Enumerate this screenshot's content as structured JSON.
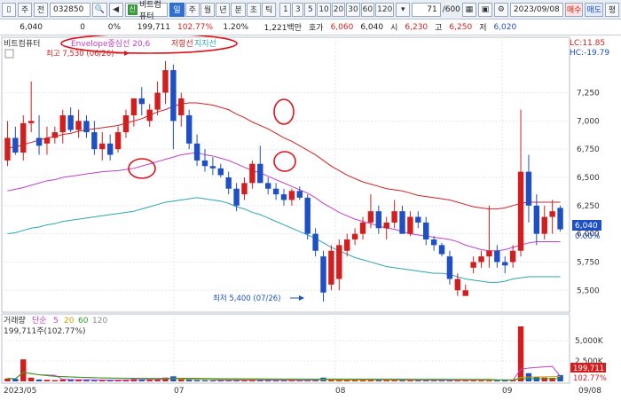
{
  "toolbar": {
    "market_label": "주",
    "prev_label": "전",
    "code": "032850",
    "stock_name": "비트컴퓨터",
    "period_tabs": [
      "일",
      "주",
      "월",
      "년",
      "분",
      "초",
      "틱"
    ],
    "active_period": "일",
    "intervals": [
      "1",
      "3",
      "5",
      "10",
      "20",
      "30",
      "60",
      "120"
    ],
    "count_value": "71",
    "count_total": "/600",
    "date_value": "2023/09/08",
    "buy_label": "매수",
    "sell_label": "매도",
    "eval_label": "평"
  },
  "info": {
    "price": "6,040",
    "change": "0",
    "change_pct": "0%",
    "volume": "199,711",
    "volume_ratio": "102.77%",
    "turnover_rate": "1.20%",
    "amount": "1,221백만",
    "quote_label": "호가",
    "quote_value": "6,060",
    "sub_value": "6,040",
    "open_label": "시",
    "open_value": "6,230",
    "high_label": "고",
    "high_value": "6,250",
    "low_label": "저",
    "low_value": "6,020"
  },
  "price_panel": {
    "title": "비트컴퓨터",
    "legend_envelope": "Envelope중심선 20,6",
    "legend_resistance": "저항선",
    "legend_support": "지지선",
    "lc_label": "LC:11.85",
    "hc_label": "HC:-19.79",
    "high_annotation": "최고 7,530 (06/26)",
    "low_annotation": "최저 5,400 (07/26)",
    "current_price_label": "6,040",
    "current_pct_label": "0.00%",
    "y_ticks": [
      "7,250",
      "7,000",
      "6,750",
      "6,500",
      "6,250",
      "6,000",
      "5,750",
      "5,500"
    ]
  },
  "volume_panel": {
    "title": "거래량",
    "legend_simple": "단순",
    "ma_labels": [
      "5",
      "20",
      "60",
      "120"
    ],
    "current_volume": "199,711주(102.77%)",
    "y_ticks": [
      "5,000K",
      "2,500K"
    ],
    "badge_value": "199,711",
    "badge_pct": "102.77%"
  },
  "x_axis": {
    "labels": [
      "2023/05",
      "07",
      "08",
      "09",
      "09/08"
    ]
  },
  "colors": {
    "up": "#d21e1e",
    "down": "#1f4fc4",
    "envelope_center": "#c040c8",
    "resistance": "#d22020",
    "support": "#2aa6b5",
    "annotation": "#e0101a"
  },
  "chart_data": {
    "type": "candlestick",
    "title": "비트컴퓨터",
    "ylim": [
      5400,
      7600
    ],
    "candles": [
      {
        "o": 6650,
        "h": 7000,
        "l": 6600,
        "c": 6850
      },
      {
        "o": 6850,
        "h": 6950,
        "l": 6700,
        "c": 6720
      },
      {
        "o": 6720,
        "h": 7050,
        "l": 6650,
        "c": 6980
      },
      {
        "o": 6980,
        "h": 7350,
        "l": 6900,
        "c": 7000
      },
      {
        "o": 6850,
        "h": 7050,
        "l": 6700,
        "c": 6780
      },
      {
        "o": 6800,
        "h": 6950,
        "l": 6700,
        "c": 6850
      },
      {
        "o": 6850,
        "h": 6950,
        "l": 6800,
        "c": 6900
      },
      {
        "o": 6900,
        "h": 7100,
        "l": 6800,
        "c": 7050
      },
      {
        "o": 7050,
        "h": 7120,
        "l": 6900,
        "c": 6920
      },
      {
        "o": 6920,
        "h": 7100,
        "l": 6850,
        "c": 7000
      },
      {
        "o": 7000,
        "h": 7050,
        "l": 6850,
        "c": 6900
      },
      {
        "o": 6900,
        "h": 7000,
        "l": 6700,
        "c": 6750
      },
      {
        "o": 6750,
        "h": 6900,
        "l": 6650,
        "c": 6800
      },
      {
        "o": 6800,
        "h": 6880,
        "l": 6650,
        "c": 6700
      },
      {
        "o": 6750,
        "h": 6950,
        "l": 6720,
        "c": 6900
      },
      {
        "o": 6900,
        "h": 7100,
        "l": 6850,
        "c": 7050
      },
      {
        "o": 7050,
        "h": 7200,
        "l": 6950,
        "c": 7200
      },
      {
        "o": 7200,
        "h": 7300,
        "l": 7050,
        "c": 7150
      },
      {
        "o": 7000,
        "h": 7150,
        "l": 6950,
        "c": 7100
      },
      {
        "o": 7100,
        "h": 7350,
        "l": 7050,
        "c": 7250
      },
      {
        "o": 7250,
        "h": 7530,
        "l": 7150,
        "c": 7450
      },
      {
        "o": 7450,
        "h": 7500,
        "l": 6750,
        "c": 7000
      },
      {
        "o": 7050,
        "h": 7250,
        "l": 6950,
        "c": 7200
      },
      {
        "o": 7050,
        "h": 7100,
        "l": 6750,
        "c": 6800
      },
      {
        "o": 6800,
        "h": 6880,
        "l": 6600,
        "c": 6650
      },
      {
        "o": 6650,
        "h": 6750,
        "l": 6550,
        "c": 6600
      },
      {
        "o": 6600,
        "h": 6680,
        "l": 6520,
        "c": 6580
      },
      {
        "o": 6580,
        "h": 6620,
        "l": 6500,
        "c": 6520
      },
      {
        "o": 6500,
        "h": 6550,
        "l": 6350,
        "c": 6400
      },
      {
        "o": 6400,
        "h": 6450,
        "l": 6200,
        "c": 6250
      },
      {
        "o": 6350,
        "h": 6500,
        "l": 6300,
        "c": 6450
      },
      {
        "o": 6450,
        "h": 6650,
        "l": 6400,
        "c": 6620
      },
      {
        "o": 6620,
        "h": 6780,
        "l": 6550,
        "c": 6450
      },
      {
        "o": 6450,
        "h": 6500,
        "l": 6350,
        "c": 6400
      },
      {
        "o": 6400,
        "h": 6450,
        "l": 6300,
        "c": 6350
      },
      {
        "o": 6350,
        "h": 6400,
        "l": 6250,
        "c": 6300
      },
      {
        "o": 6300,
        "h": 6400,
        "l": 6250,
        "c": 6380
      },
      {
        "o": 6380,
        "h": 6420,
        "l": 6300,
        "c": 6320
      },
      {
        "o": 6320,
        "h": 6350,
        "l": 5950,
        "c": 6000
      },
      {
        "o": 6000,
        "h": 6050,
        "l": 5800,
        "c": 5850
      },
      {
        "o": 5800,
        "h": 5850,
        "l": 5400,
        "c": 5480
      },
      {
        "o": 5550,
        "h": 5900,
        "l": 5500,
        "c": 5850
      },
      {
        "o": 5600,
        "h": 5950,
        "l": 5500,
        "c": 5900
      },
      {
        "o": 5850,
        "h": 6000,
        "l": 5800,
        "c": 5950
      },
      {
        "o": 5950,
        "h": 6050,
        "l": 5900,
        "c": 6000
      },
      {
        "o": 6000,
        "h": 6150,
        "l": 5950,
        "c": 6100
      },
      {
        "o": 6100,
        "h": 6350,
        "l": 6050,
        "c": 6200
      },
      {
        "o": 6200,
        "h": 6250,
        "l": 6000,
        "c": 6050
      },
      {
        "o": 6050,
        "h": 6150,
        "l": 5950,
        "c": 6100
      },
      {
        "o": 6100,
        "h": 6300,
        "l": 6050,
        "c": 6200
      },
      {
        "o": 6200,
        "h": 6250,
        "l": 6000,
        "c": 6000
      },
      {
        "o": 6000,
        "h": 6200,
        "l": 5980,
        "c": 6150
      },
      {
        "o": 6150,
        "h": 6200,
        "l": 6050,
        "c": 6100
      },
      {
        "o": 6100,
        "h": 6150,
        "l": 5900,
        "c": 5950
      },
      {
        "o": 5950,
        "h": 5980,
        "l": 5850,
        "c": 5900
      },
      {
        "o": 5900,
        "h": 5920,
        "l": 5800,
        "c": 5820
      },
      {
        "o": 5800,
        "h": 5850,
        "l": 5550,
        "c": 5600
      },
      {
        "o": 5500,
        "h": 5650,
        "l": 5450,
        "c": 5600
      },
      {
        "o": 5450,
        "h": 5550,
        "l": 5450,
        "c": 5500
      },
      {
        "o": 5700,
        "h": 5800,
        "l": 5650,
        "c": 5750
      },
      {
        "o": 5750,
        "h": 5850,
        "l": 5700,
        "c": 5800
      },
      {
        "o": 5800,
        "h": 6250,
        "l": 5700,
        "c": 5850
      },
      {
        "o": 5850,
        "h": 5900,
        "l": 5700,
        "c": 5750
      },
      {
        "o": 5750,
        "h": 5800,
        "l": 5650,
        "c": 5720
      },
      {
        "o": 5750,
        "h": 5900,
        "l": 5700,
        "c": 5850
      },
      {
        "o": 5850,
        "h": 7100,
        "l": 5800,
        "c": 6550
      },
      {
        "o": 6550,
        "h": 6700,
        "l": 6100,
        "c": 6250
      },
      {
        "o": 6250,
        "h": 6350,
        "l": 5900,
        "c": 6000
      },
      {
        "o": 6000,
        "h": 6250,
        "l": 5950,
        "c": 6150
      },
      {
        "o": 6150,
        "h": 6300,
        "l": 6000,
        "c": 6200
      },
      {
        "o": 6230,
        "h": 6250,
        "l": 6020,
        "c": 6040
      }
    ],
    "envelope_center": [
      6380,
      6395,
      6410,
      6430,
      6450,
      6470,
      6480,
      6500,
      6510,
      6520,
      6530,
      6540,
      6550,
      6555,
      6560,
      6570,
      6580,
      6600,
      6620,
      6640,
      6660,
      6680,
      6700,
      6710,
      6720,
      6700,
      6690,
      6670,
      6650,
      6620,
      6590,
      6560,
      6540,
      6510,
      6480,
      6450,
      6420,
      6390,
      6360,
      6320,
      6270,
      6230,
      6190,
      6160,
      6130,
      6110,
      6090,
      6070,
      6050,
      6040,
      6020,
      6000,
      5990,
      5980,
      5970,
      5960,
      5950,
      5930,
      5900,
      5880,
      5860,
      5850,
      5850,
      5860,
      5880,
      5900,
      5920,
      5930,
      5930,
      5930,
      5930
    ],
    "resistance": [
      6760,
      6770,
      6790,
      6810,
      6830,
      6850,
      6860,
      6880,
      6890,
      6910,
      6920,
      6930,
      6940,
      6950,
      6960,
      6980,
      7000,
      7020,
      7050,
      7080,
      7100,
      7130,
      7150,
      7160,
      7160,
      7150,
      7140,
      7120,
      7100,
      7060,
      7030,
      6990,
      6960,
      6930,
      6890,
      6850,
      6820,
      6780,
      6740,
      6700,
      6650,
      6600,
      6560,
      6520,
      6490,
      6460,
      6440,
      6420,
      6400,
      6390,
      6380,
      6360,
      6340,
      6330,
      6320,
      6310,
      6300,
      6280,
      6260,
      6240,
      6230,
      6220,
      6220,
      6230,
      6250,
      6270,
      6280,
      6280,
      6280,
      6280,
      6280
    ],
    "support": [
      6000,
      6010,
      6030,
      6050,
      6060,
      6080,
      6090,
      6110,
      6120,
      6130,
      6140,
      6150,
      6160,
      6170,
      6180,
      6190,
      6200,
      6220,
      6240,
      6260,
      6280,
      6290,
      6300,
      6310,
      6320,
      6310,
      6300,
      6290,
      6270,
      6240,
      6220,
      6190,
      6170,
      6140,
      6110,
      6080,
      6050,
      6020,
      5990,
      5960,
      5920,
      5880,
      5850,
      5820,
      5790,
      5770,
      5750,
      5730,
      5710,
      5700,
      5690,
      5680,
      5670,
      5660,
      5650,
      5650,
      5640,
      5620,
      5600,
      5590,
      5580,
      5570,
      5570,
      5580,
      5600,
      5610,
      5620,
      5620,
      5620,
      5620,
      5620
    ],
    "volume": [
      90,
      80,
      700,
      120,
      60,
      50,
      40,
      60,
      70,
      50,
      40,
      35,
      40,
      30,
      50,
      60,
      80,
      70,
      50,
      60,
      120,
      160,
      90,
      60,
      40,
      35,
      30,
      30,
      40,
      50,
      40,
      50,
      40,
      35,
      30,
      30,
      35,
      30,
      40,
      60,
      120,
      70,
      60,
      50,
      50,
      45,
      60,
      50,
      40,
      40,
      45,
      40,
      35,
      30,
      30,
      35,
      40,
      45,
      35,
      40,
      35,
      60,
      40,
      35,
      40,
      1750,
      260,
      140,
      120,
      110,
      200
    ],
    "volume_max": 6000
  }
}
